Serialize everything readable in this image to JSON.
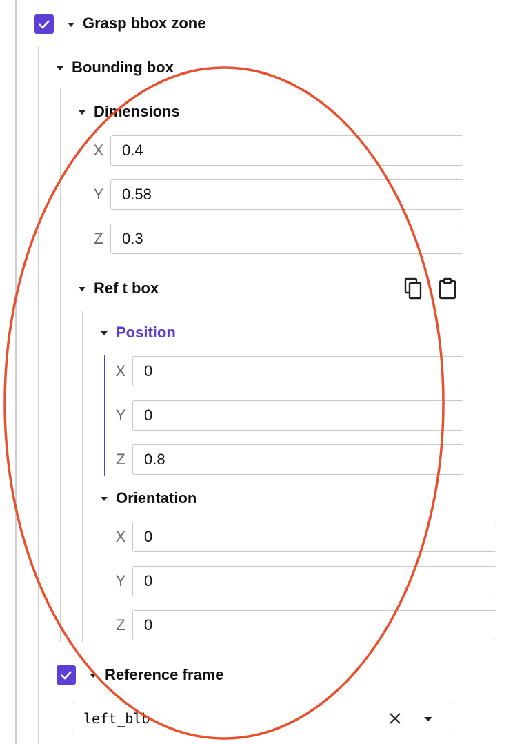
{
  "grasp_zone": {
    "title": "Grasp bbox zone",
    "checked": true,
    "bounding_box": {
      "title": "Bounding box",
      "dimensions": {
        "title": "Dimensions",
        "fields": [
          {
            "axis": "X",
            "value": "0.4"
          },
          {
            "axis": "Y",
            "value": "0.58"
          },
          {
            "axis": "Z",
            "value": "0.3"
          }
        ]
      },
      "ref_box": {
        "title": "Ref t box",
        "copy_icon": "copy-icon",
        "paste_icon": "clipboard-icon",
        "position": {
          "title": "Position",
          "fields": [
            {
              "axis": "X",
              "value": "0"
            },
            {
              "axis": "Y",
              "value": "0"
            },
            {
              "axis": "Z",
              "value": "0.8"
            }
          ]
        },
        "orientation": {
          "title": "Orientation",
          "fields": [
            {
              "axis": "X",
              "value": "0"
            },
            {
              "axis": "Y",
              "value": "0"
            },
            {
              "axis": "Z",
              "value": "0"
            }
          ]
        }
      }
    },
    "reference_frame": {
      "title": "Reference frame",
      "checked": true,
      "value": "left_blb"
    }
  },
  "colors": {
    "accent": "#5b3fd6",
    "annotation_circle": "#e8502e",
    "field_border": "#c8c8c8"
  }
}
